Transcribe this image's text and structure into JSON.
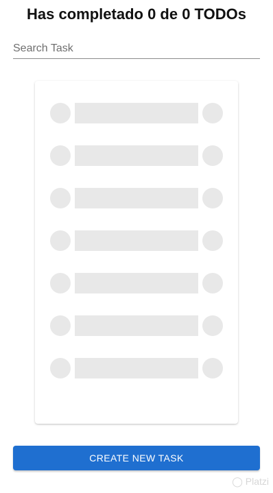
{
  "header": {
    "title": "Has completado 0 de 0 TODOs"
  },
  "search": {
    "placeholder": "Search Task",
    "value": ""
  },
  "list": {
    "skeleton_rows": 7
  },
  "actions": {
    "create_label": "CREATE NEW TASK"
  },
  "watermark": {
    "text": "Platzi"
  },
  "colors": {
    "primary": "#1f6fd0",
    "skeleton": "#e8e8e8"
  }
}
